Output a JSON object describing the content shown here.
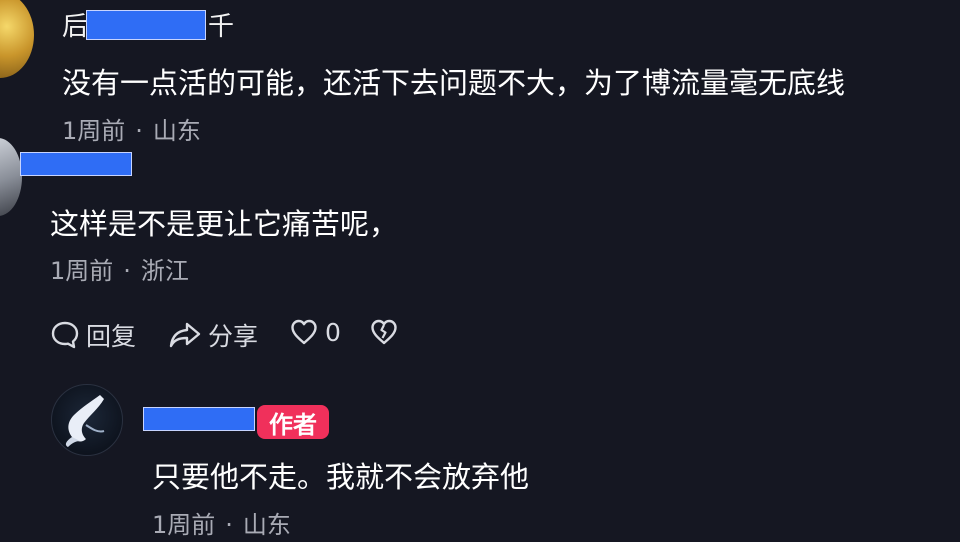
{
  "comments": [
    {
      "author_visible": "后",
      "author_visible_tail": "千",
      "text": "没有一点活的可能，还活下去问题不大，为了博流量毫无底线",
      "time": "1周前",
      "location": "山东"
    },
    {
      "text": "这样是不是更让它痛苦呢，",
      "time": "1周前",
      "location": "浙江"
    },
    {
      "author_badge": "作者",
      "text": "只要他不走。我就不会放弃他",
      "time": "1周前",
      "location": "山东"
    }
  ],
  "actions": {
    "reply": "回复",
    "share": "分享",
    "like_count": "0"
  },
  "meta_separator": "·",
  "icons": [
    "avatar",
    "comment-bubble-icon",
    "share-arrow-icon",
    "heart-icon",
    "broken-heart-icon"
  ],
  "colors": {
    "background": "#151722",
    "badge": "#f0305b",
    "meta_text": "#a9abb5",
    "redaction": "#2f6df5"
  }
}
